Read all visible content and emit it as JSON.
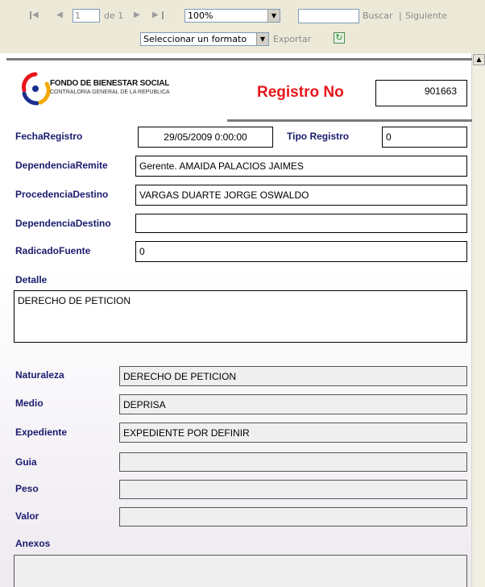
{
  "toolbar": {
    "page_current": "1",
    "page_of": "de 1",
    "zoom": "100%",
    "search_value": "",
    "search_label": "Buscar",
    "separator": "|",
    "next_label": "Siguiente",
    "format_select": "Seleccionar un formato",
    "export_label": "Exportar"
  },
  "header": {
    "logo_title": "FONDO DE BIENESTAR SOCIAL",
    "logo_subtitle": "CONTRALORIA GENERAL DE LA REPUBLICA",
    "registro_title": "Registro No",
    "registro_number": "901663"
  },
  "fields": {
    "fecha_registro_label": "FechaRegistro",
    "fecha_registro_value": "29/05/2009 0:00:00",
    "tipo_registro_label": "Tipo Registro",
    "tipo_registro_value": "0",
    "dependencia_remite_label": "DependenciaRemite",
    "dependencia_remite_value": "Gerente. AMAIDA PALACIOS JAIMES",
    "procedencia_destino_label": "ProcedenciaDestino",
    "procedencia_destino_value": "VARGAS DUARTE JORGE OSWALDO",
    "dependencia_destino_label": "DependenciaDestino",
    "dependencia_destino_value": "",
    "radicado_fuente_label": "RadicadoFuente",
    "radicado_fuente_value": "0",
    "detalle_label": "Detalle",
    "detalle_value": "DERECHO DE PETICION",
    "naturaleza_label": "Naturaleza",
    "naturaleza_value": "DERECHO DE PETICION",
    "medio_label": "Medio",
    "medio_value": "DEPRISA",
    "expediente_label": "Expediente",
    "expediente_value": "EXPEDIENTE POR DEFINIR",
    "guia_label": "Guia",
    "guia_value": "",
    "peso_label": "Peso",
    "peso_value": "",
    "valor_label": "Valor",
    "valor_value": "",
    "anexos_label": "Anexos",
    "anexos_value": ""
  },
  "colors": {
    "toolbar_bg": "#ece9d8",
    "label_color": "#1b1b6f",
    "registro_red": "#e8161b"
  }
}
